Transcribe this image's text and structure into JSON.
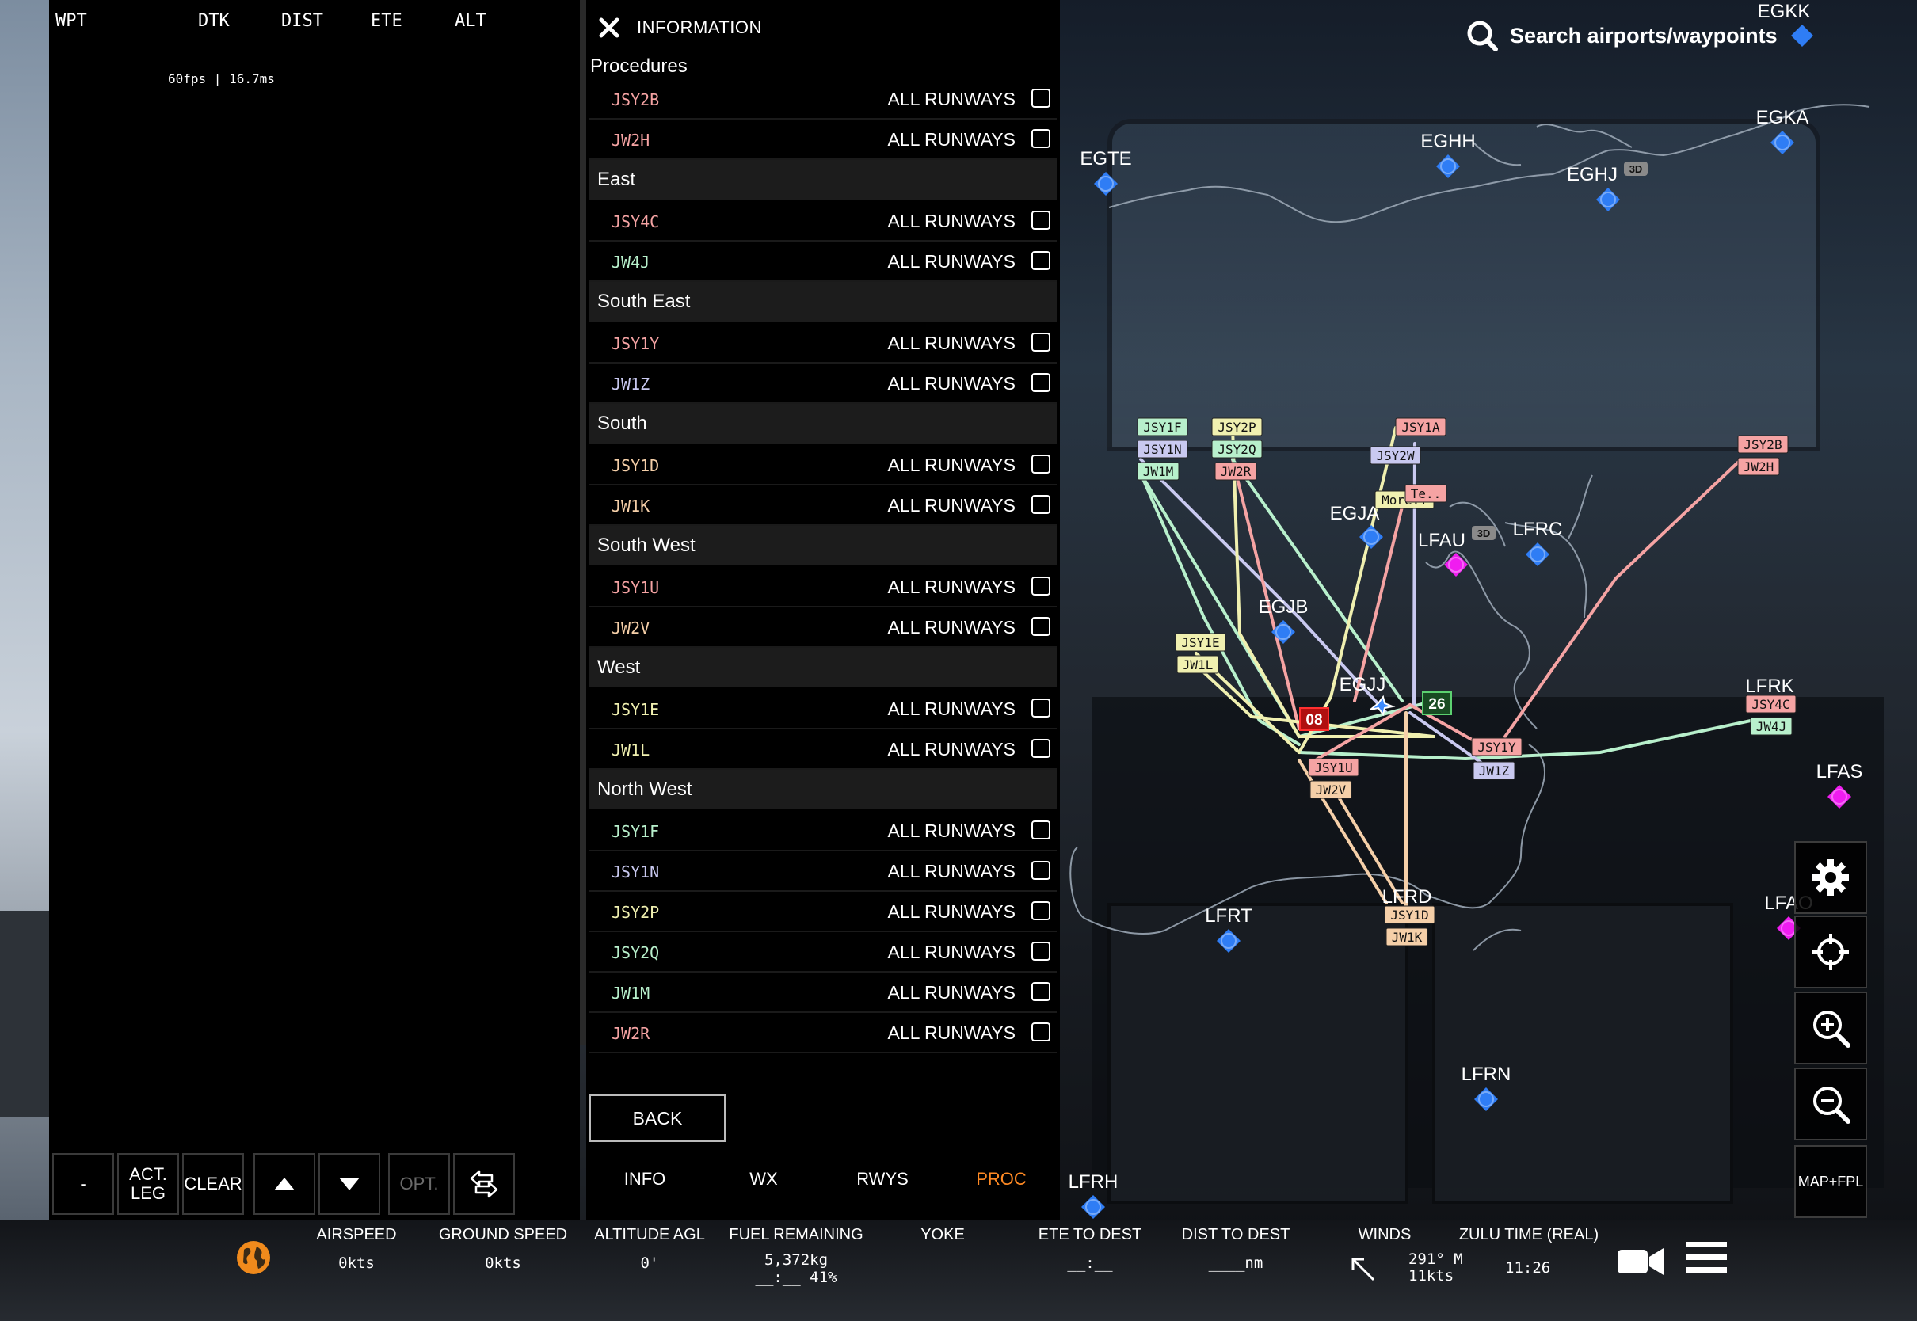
{
  "fpl": {
    "columns": [
      "WPT",
      "DTK",
      "DIST",
      "ETE",
      "ALT"
    ],
    "fps_text": "60fps | 16.7ms",
    "toolbar": {
      "minus": "-",
      "act_leg_line1": "ACT.",
      "act_leg_line2": "LEG",
      "clear": "CLEAR",
      "opt": "OPT."
    }
  },
  "info": {
    "title": "INFORMATION",
    "procedures_heading": "Procedures",
    "runways_label": "ALL RUNWAYS",
    "groups": [
      {
        "name": "",
        "items": [
          {
            "name": "JSY2B",
            "color": "#f5a3a3"
          },
          {
            "name": "JW2H",
            "color": "#f5a3a3"
          }
        ]
      },
      {
        "name": "East",
        "items": [
          {
            "name": "JSY4C",
            "color": "#f5a3a3"
          },
          {
            "name": "JW4J",
            "color": "#b8f0cc"
          }
        ]
      },
      {
        "name": "South East",
        "items": [
          {
            "name": "JSY1Y",
            "color": "#f5a3a3"
          },
          {
            "name": "JW1Z",
            "color": "#c9c9f0"
          }
        ]
      },
      {
        "name": "South",
        "items": [
          {
            "name": "JSY1D",
            "color": "#f5cfa8"
          },
          {
            "name": "JW1K",
            "color": "#f5cfa8"
          }
        ]
      },
      {
        "name": "South West",
        "items": [
          {
            "name": "JSY1U",
            "color": "#f5a3a3"
          },
          {
            "name": "JW2V",
            "color": "#f5cfa8"
          }
        ]
      },
      {
        "name": "West",
        "items": [
          {
            "name": "JSY1E",
            "color": "#f0f0b0"
          },
          {
            "name": "JW1L",
            "color": "#f0f0b0"
          }
        ]
      },
      {
        "name": "North West",
        "items": [
          {
            "name": "JSY1F",
            "color": "#b8f0cc"
          },
          {
            "name": "JSY1N",
            "color": "#c9c9f0"
          },
          {
            "name": "JSY2P",
            "color": "#f0f0b0"
          },
          {
            "name": "JSY2Q",
            "color": "#b8f0cc"
          },
          {
            "name": "JW1M",
            "color": "#b8f0cc"
          },
          {
            "name": "JW2R",
            "color": "#f5a3a3"
          }
        ]
      }
    ],
    "back_label": "BACK",
    "tabs": [
      "INFO",
      "WX",
      "RWYS",
      "PROC"
    ],
    "active_tab": "PROC"
  },
  "map": {
    "search_placeholder": "Search airports/waypoints",
    "airports_blue": [
      "EGTE",
      "EGHH",
      "EGHJ",
      "EGKA",
      "EGJA",
      "LFRC",
      "EGJB",
      "LFRT",
      "LFRN",
      "LFRH"
    ],
    "airports_magenta": [
      "LFAU",
      "LFAS",
      "LFAO"
    ],
    "partial_labels": [
      "EGKK",
      "LFRK",
      "LFRD"
    ],
    "current_airport": "EGJJ",
    "runway_labels": [
      "08",
      "26"
    ],
    "badge_3d": "3D",
    "route_tags": [
      "JSY1F",
      "JSY1N",
      "JW1M",
      "JSY2P",
      "JSY2Q",
      "JW2R",
      "JSY1A",
      "JSY2W",
      "More..",
      "Te..",
      "JSY2B",
      "JW2H",
      "JSY1E",
      "JW1L",
      "JSY4C",
      "JW4J",
      "JSY1Y",
      "JW1Z",
      "JSY1U",
      "JW2V",
      "JSY1D",
      "JW1K"
    ],
    "colors": {
      "airport_blue": "#2f7df5",
      "airport_magenta": "#f01cf0",
      "coast": "#9aa6b4"
    },
    "map_button_label": "MAP+FPL"
  },
  "status": {
    "items": [
      {
        "label": "AIRSPEED",
        "value": "0kts"
      },
      {
        "label": "GROUND SPEED",
        "value": "0kts"
      },
      {
        "label": "ALTITUDE AGL",
        "value": "0'"
      },
      {
        "label": "FUEL REMAINING",
        "value": "5,372kg",
        "value2": "__:__ 41%"
      },
      {
        "label": "YOKE",
        "value": ""
      },
      {
        "label": "ETE TO DEST",
        "value": "__:__"
      },
      {
        "label": "DIST TO DEST",
        "value": "____nm"
      },
      {
        "label": "WINDS",
        "value": "291° M",
        "value2": "11kts"
      },
      {
        "label": "ZULU TIME (REAL)",
        "value": "11:26"
      }
    ]
  }
}
